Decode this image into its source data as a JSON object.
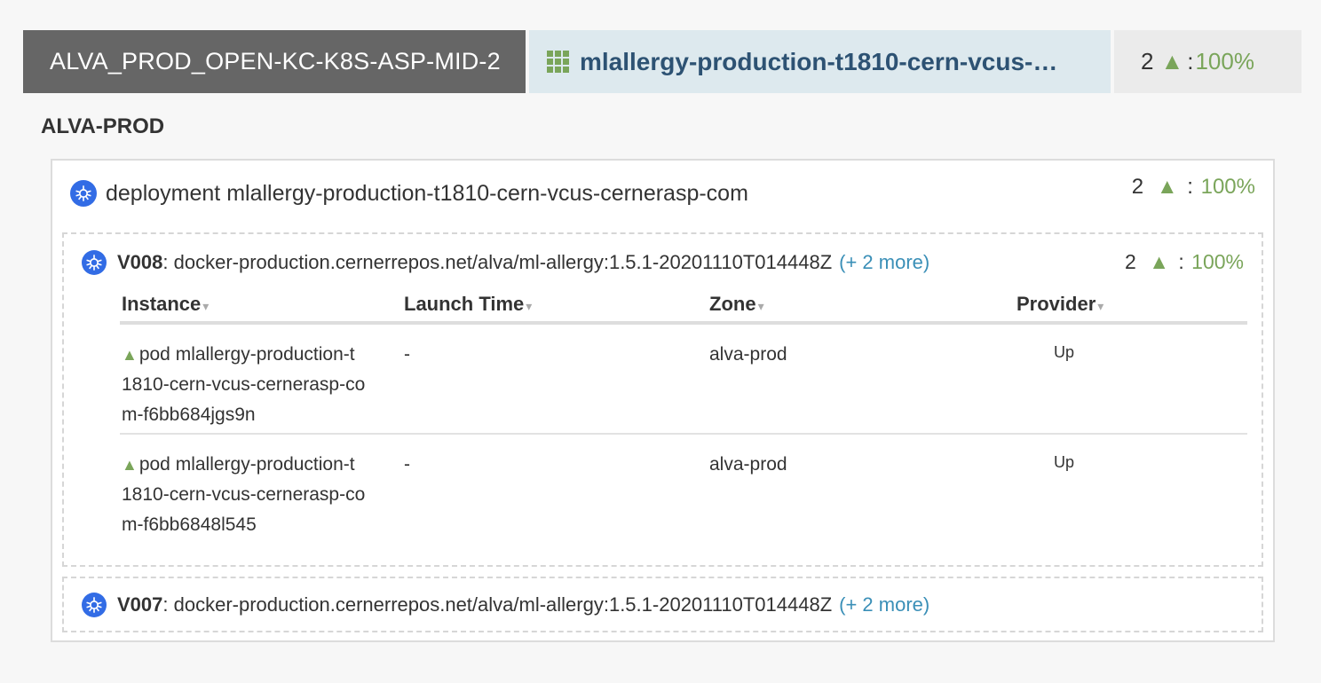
{
  "topbar": {
    "account": "ALVA_PROD_OPEN-KC-K8S-ASP-MID-2",
    "cluster": "mlallergy-production-t1810-cern-vcus-…",
    "health_count": "2",
    "health_pct": "100%"
  },
  "region": "ALVA-PROD",
  "server_group": {
    "title": "deployment mlallergy-production-t1810-cern-vcus-cernerasp-com",
    "health_count": "2",
    "health_pct": "100%"
  },
  "versions": [
    {
      "id": "V008",
      "image": "docker-production.cernerrepos.net/alva/ml-allergy:1.5.1-20201110T014448Z",
      "more": "(+ 2 more)",
      "health_count": "2",
      "health_pct": "100%",
      "table": {
        "headers": [
          "Instance",
          "Launch Time",
          "Zone",
          "Provider"
        ],
        "rows": [
          {
            "instance_line1": "pod mlallergy-production-t",
            "instance_line2": "1810-cern-vcus-cernerasp-co",
            "instance_line3": "m-f6bb684jgs9n",
            "launch_time": "-",
            "zone": "alva-prod",
            "provider": "Up"
          },
          {
            "instance_line1": "pod mlallergy-production-t",
            "instance_line2": "1810-cern-vcus-cernerasp-co",
            "instance_line3": "m-f6bb6848l545",
            "launch_time": "-",
            "zone": "alva-prod",
            "provider": "Up"
          }
        ]
      }
    },
    {
      "id": "V007",
      "image": "docker-production.cernerrepos.net/alva/ml-allergy:1.5.1-20201110T014448Z",
      "more": "(+ 2 more)"
    }
  ],
  "symbols": {
    "up": "▲",
    "sort": "▾",
    "colon": ":"
  },
  "colors": {
    "healthy": "#7aa55a",
    "link": "#3a8fb7",
    "k8s": "#326ce5",
    "account_bg": "#666666",
    "cluster_bg": "#dde9ee"
  }
}
